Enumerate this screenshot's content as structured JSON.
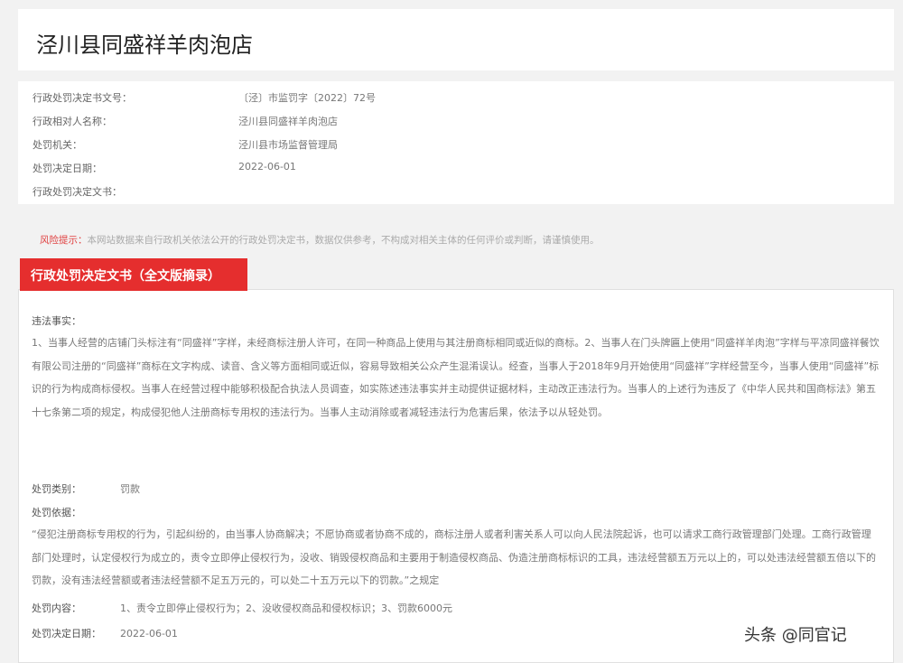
{
  "header": {
    "title": "泾川县同盛祥羊肉泡店"
  },
  "info": {
    "rows": [
      {
        "label": "行政处罚决定书文号：",
        "value": "〔泾〕市监罚字〔2022〕72号"
      },
      {
        "label": "行政相对人名称：",
        "value": "泾川县同盛祥羊肉泡店"
      },
      {
        "label": "处罚机关：",
        "value": "泾川县市场监督管理局"
      },
      {
        "label": "处罚决定日期：",
        "value": "2022-06-01"
      },
      {
        "label": "行政处罚决定文书：",
        "value": ""
      }
    ]
  },
  "notice": {
    "tag": "风险提示：",
    "text": "本网站数据来自行政机关依法公开的行政处罚决定书，数据仅供参考，不构成对相关主体的任何评价或判断，请谨慎使用。"
  },
  "document": {
    "tab_label": "行政处罚决定文书（全文版摘录）",
    "facts_heading": "违法事实：",
    "facts_text": "1、当事人经营的店铺门头标注有“同盛祥”字样，未经商标注册人许可，在同一种商品上使用与其注册商标相同或近似的商标。2、当事人在门头牌匾上使用“同盛祥羊肉泡”字样与平凉同盛祥餐饮有限公司注册的“同盛祥”商标在文字构成、读音、含义等方面相同或近似，容易导致相关公众产生混淆误认。经查，当事人于2018年9月开始使用“同盛祥”字样经营至今，当事人使用“同盛祥”标识的行为构成商标侵权。当事人在经营过程中能够积极配合执法人员调查，如实陈述违法事实并主动提供证据材料，主动改正违法行为。当事人的上述行为违反了《中华人民共和国商标法》第五十七条第二项的规定，构成侵犯他人注册商标专用权的违法行为。当事人主动消除或者减轻违法行为危害后果，依法予以从轻处罚。",
    "basis_type_label": "处罚类别：",
    "basis_type_value": "罚款",
    "basis_heading": "处罚依据：",
    "basis_text": "“侵犯注册商标专用权的行为，引起纠纷的，由当事人协商解决；不愿协商或者协商不成的，商标注册人或者利害关系人可以向人民法院起诉，也可以请求工商行政管理部门处理。工商行政管理部门处理时，认定侵权行为成立的，责令立即停止侵权行为，没收、销毁侵权商品和主要用于制造侵权商品、伪造注册商标标识的工具，违法经营额五万元以上的，可以处违法经营额五倍以下的罚款，没有违法经营额或者违法经营额不足五万元的，可以处二十五万元以下的罚款。”之规定",
    "content_label": "处罚内容：",
    "content_value": "1、责令立即停止侵权行为；2、没收侵权商品和侵权标识；3、罚款6000元",
    "date_label": "处罚决定日期：",
    "date_value": "2022-06-01"
  },
  "watermark": {
    "text": "头条 @同官记"
  }
}
